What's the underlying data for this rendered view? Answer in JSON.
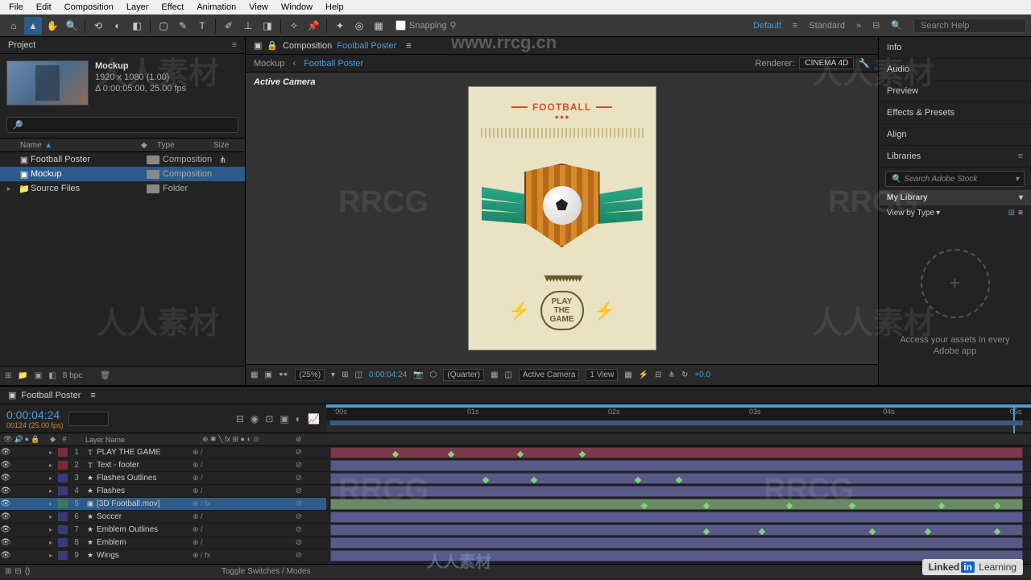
{
  "menu": [
    "File",
    "Edit",
    "Composition",
    "Layer",
    "Effect",
    "Animation",
    "View",
    "Window",
    "Help"
  ],
  "toolbar": {
    "snapping": "Snapping",
    "workspace_default": "Default",
    "workspace_standard": "Standard",
    "search_placeholder": "Search Help"
  },
  "project": {
    "tab": "Project",
    "selected": {
      "name": "Mockup",
      "dims": "1920 x 1080 (1.00)",
      "dur": "Δ 0:00:05:00, 25.00 fps"
    },
    "cols": {
      "name": "Name",
      "type": "Type",
      "size": "Size"
    },
    "items": [
      {
        "name": "Football Poster",
        "type": "Composition",
        "icon": "comp"
      },
      {
        "name": "Mockup",
        "type": "Composition",
        "icon": "comp",
        "sel": true
      },
      {
        "name": "Source Files",
        "type": "Folder",
        "icon": "folder",
        "exp": true
      }
    ],
    "bpc": "8 bpc"
  },
  "comp": {
    "label": "Composition",
    "name": "Football Poster",
    "crumb1": "Mockup",
    "crumb2": "Football Poster",
    "renderer_label": "Renderer:",
    "renderer": "CINEMA 4D",
    "active_camera": "Active Camera",
    "poster": {
      "banner": "FOOTBALL",
      "play1": "PLAY",
      "play2": "THE",
      "play3": "GAME"
    },
    "viewer_bar": {
      "zoom": "(25%)",
      "tc": "0:00:04:24",
      "quality": "(Quarter)",
      "camera": "Active Camera",
      "views": "1 View",
      "exposure": "+0.0"
    }
  },
  "panels": {
    "info": "Info",
    "audio": "Audio",
    "preview": "Preview",
    "effects": "Effects & Presets",
    "align": "Align",
    "libraries": "Libraries",
    "search_stock": "Search Adobe Stock",
    "my_library": "My Library",
    "view_by": "View by Type",
    "empty": "Access your assets in every Adobe app"
  },
  "timeline": {
    "tab": "Football Poster",
    "tc": "0:00:04:24",
    "frame": "00124 (25.00 fps)",
    "ruler": [
      ":00s",
      "01s",
      "02s",
      "03s",
      "04s",
      "05s"
    ],
    "col_name": "Layer Name",
    "layers": [
      {
        "n": 1,
        "name": "PLAY THE GAME",
        "icon": "T",
        "color": "#7a2a3a",
        "sw": "⊕   /",
        "par": "⊘",
        "bar": "#7a3a4a",
        "kf": [
          9,
          17,
          27,
          36
        ]
      },
      {
        "n": 2,
        "name": "Text - footer",
        "icon": "T",
        "color": "#7a2a3a",
        "sw": "⊕   /",
        "par": "⊘",
        "bar": "#5a5a8a"
      },
      {
        "n": 3,
        "name": "Flashes Outlines",
        "icon": "★",
        "color": "#3a3a7a",
        "sw": "⊕   /",
        "par": "⊘",
        "bar": "#5a5a8a",
        "kf": [
          22,
          29,
          44,
          50
        ]
      },
      {
        "n": 4,
        "name": "Flashes",
        "icon": "★",
        "color": "#3a3a7a",
        "sw": "⊕   /",
        "par": "⊘",
        "bar": "#5a5a8a"
      },
      {
        "n": 5,
        "name": "[3D Football.mov]",
        "icon": "▣",
        "color": "#3a7a5a",
        "sw": "⊕   / fx",
        "par": "⊘",
        "bar": "#6a8a6a",
        "sel": true,
        "kf": [
          45,
          54,
          66,
          75,
          88,
          96
        ]
      },
      {
        "n": 6,
        "name": "Soccer",
        "icon": "★",
        "color": "#3a3a7a",
        "sw": "⊕   /",
        "par": "⊘",
        "bar": "#5a5a8a"
      },
      {
        "n": 7,
        "name": "Emblem Outlines",
        "icon": "★",
        "color": "#3a3a7a",
        "sw": "⊕   /",
        "par": "⊘",
        "bar": "#5a5a8a",
        "kf": [
          54,
          62,
          78,
          86,
          96
        ]
      },
      {
        "n": 8,
        "name": "Emblem",
        "icon": "★",
        "color": "#3a3a7a",
        "sw": "⊕   /",
        "par": "⊘",
        "bar": "#5a5a8a"
      },
      {
        "n": 9,
        "name": "Wings",
        "icon": "★",
        "color": "#3a3a7a",
        "sw": "⊕   / fx",
        "par": "⊘",
        "bar": "#5a5a8a"
      }
    ],
    "toggle": "Toggle Switches / Modes"
  },
  "badge": {
    "linked": "Linked",
    "in": "in",
    "learning": "Learning"
  },
  "watermarks": {
    "rrcg": "RRCG",
    "site": "www.rrcg.cn",
    "cn": "人人素材"
  }
}
